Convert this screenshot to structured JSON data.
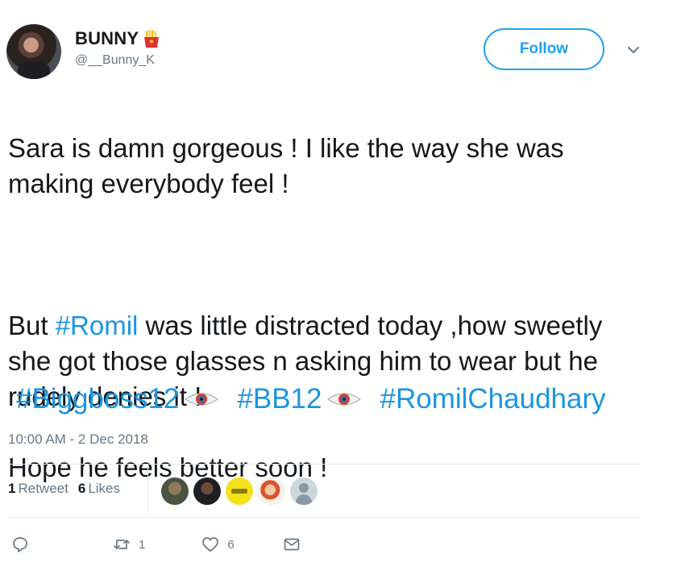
{
  "user": {
    "display_name": "BUNNY",
    "handle": "@__Bunny_K",
    "name_emoji": "fries-icon"
  },
  "follow_button": {
    "label": "Follow"
  },
  "caret": {
    "icon": "chevron-down-icon"
  },
  "tweet": {
    "paragraph_1": "Sara is damn gorgeous ! I like the way she was making everybody feel !",
    "paragraph_2_prefix": "But ",
    "paragraph_2_hashtag": "#Romil",
    "paragraph_2_rest": " was little distracted today ,how sweetly she got those glasses n asking  him to wear but he rudely denies it !",
    "paragraph_3": "Hope he feels better soon !",
    "hashtags": [
      "#Biggboss12",
      "#BB12",
      "#RomilChaudhary"
    ],
    "hashtag_emoji": "eye-icon"
  },
  "timestamp": "10:00 AM - 2 Dec 2018",
  "stats": {
    "retweets_count": "1",
    "retweets_label": "Retweet",
    "likes_count": "6",
    "likes_label": "Likes"
  },
  "actions": {
    "reply_count": "",
    "retweet_count": "1",
    "like_count": "6"
  },
  "colors": {
    "accent": "#1da1f2",
    "hashtag": "#1b95e0",
    "muted": "#657786",
    "text": "#14171a",
    "divider": "#e1e8ed"
  }
}
